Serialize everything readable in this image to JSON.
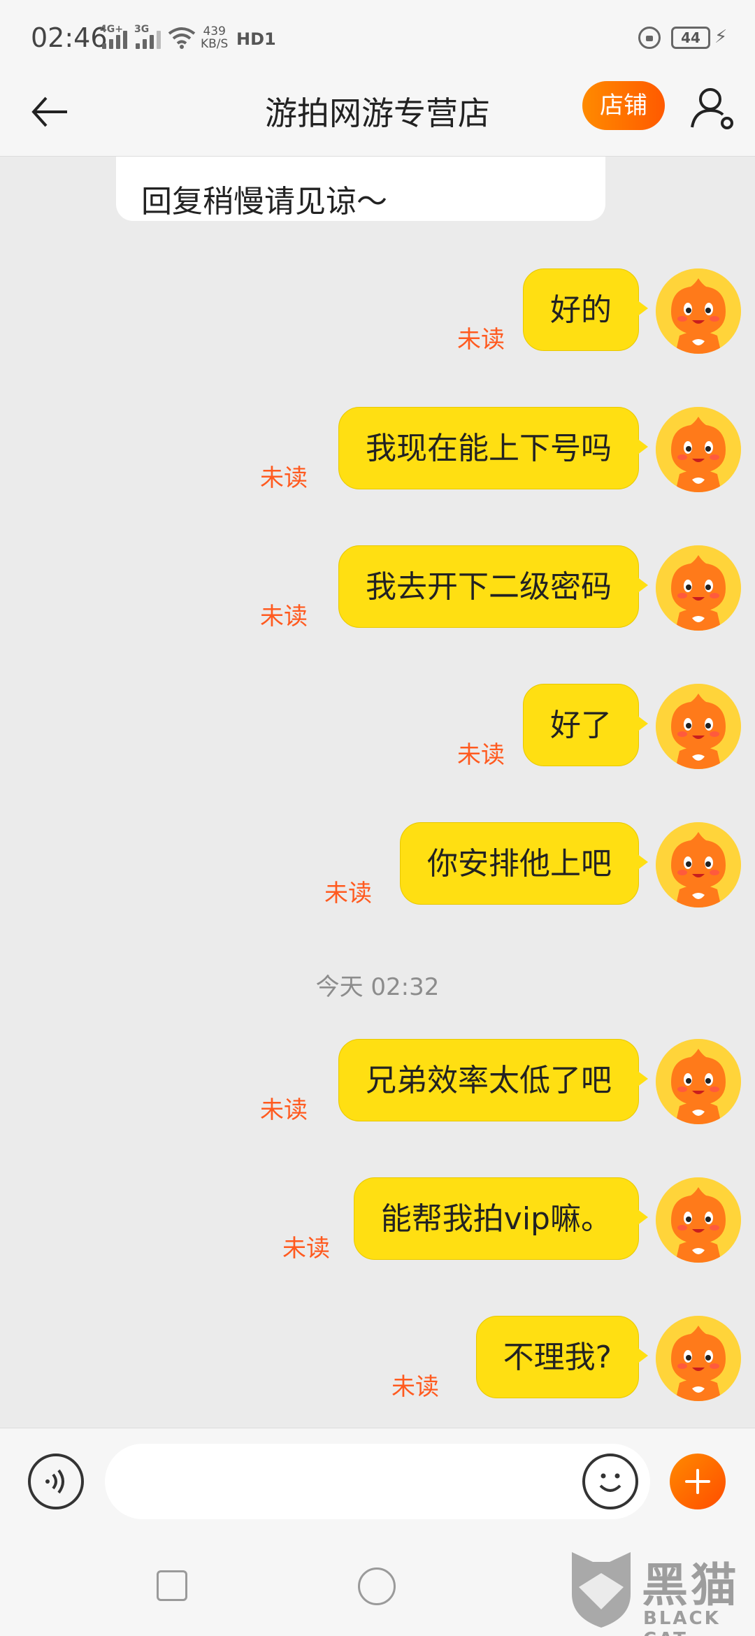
{
  "status_bar": {
    "time": "02:46",
    "net_tag_1": "4G+",
    "net_tag_2": "3G",
    "speed_value": "439",
    "speed_unit": "KB/S",
    "hd_label": "HD1",
    "battery": "44"
  },
  "header": {
    "title": "游拍网游专营店",
    "shop_button": "店铺"
  },
  "chat": {
    "previous_message": "回复稍慢请见谅～",
    "timestamp": "今天  02:32",
    "messages": [
      {
        "text": "好的",
        "status": "未读"
      },
      {
        "text": "我现在能上下号吗",
        "status": "未读"
      },
      {
        "text": "我去开下二级密码",
        "status": "未读"
      },
      {
        "text": "好了",
        "status": "未读"
      },
      {
        "text": "你安排他上吧",
        "status": "未读"
      },
      {
        "text": "兄弟效率太低了吧",
        "status": "未读"
      },
      {
        "text": "能帮我拍vip嘛。",
        "status": "未读"
      },
      {
        "text": "不理我?",
        "status": "未读"
      }
    ]
  },
  "input": {
    "placeholder": ""
  },
  "watermark": {
    "text": "黑猫",
    "subtext": "BLACK CAT"
  },
  "colors": {
    "bubble": "#ffdf12",
    "unread": "#ff5a1f",
    "accent": "#ff6a00"
  }
}
